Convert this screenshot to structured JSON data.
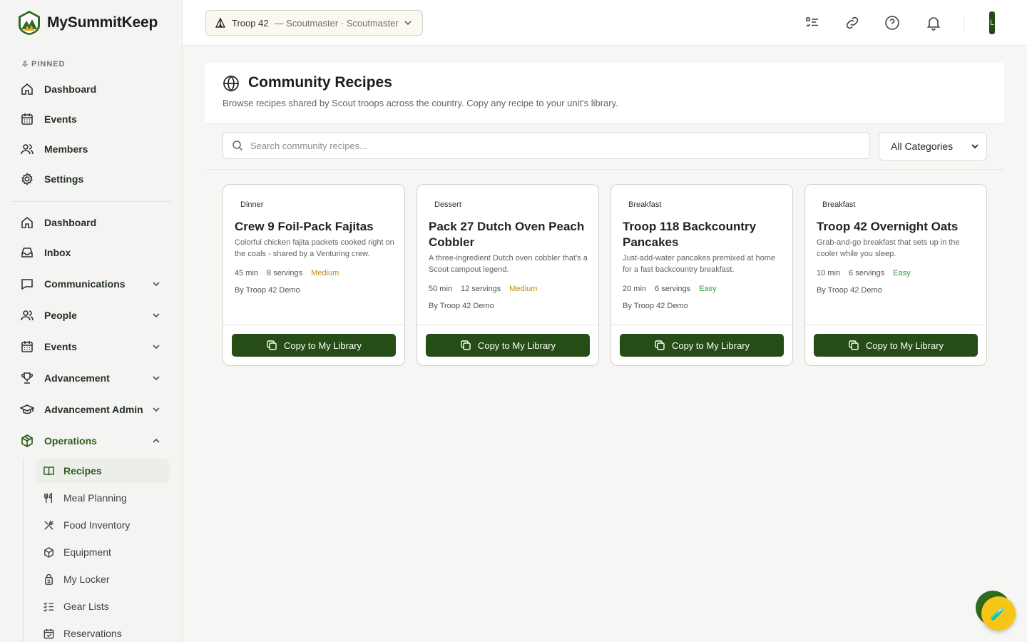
{
  "brand": {
    "name": "MySummitKeep"
  },
  "sidebar": {
    "pinned_label": "PINNED",
    "pinned": [
      {
        "label": "Dashboard",
        "icon": "home-icon"
      },
      {
        "label": "Events",
        "icon": "calendar-icon"
      },
      {
        "label": "Members",
        "icon": "users-icon"
      },
      {
        "label": "Settings",
        "icon": "gear-icon"
      }
    ],
    "nav": [
      {
        "label": "Dashboard",
        "icon": "home-icon"
      },
      {
        "label": "Inbox",
        "icon": "inbox-icon"
      },
      {
        "label": "Communications",
        "icon": "chat-icon",
        "expandable": true
      },
      {
        "label": "People",
        "icon": "users-icon",
        "expandable": true
      },
      {
        "label": "Events",
        "icon": "calendar-icon",
        "expandable": true
      },
      {
        "label": "Advancement",
        "icon": "trophy-icon",
        "expandable": true
      },
      {
        "label": "Advancement Admin",
        "icon": "graduation-cap-icon",
        "expandable": true
      },
      {
        "label": "Operations",
        "icon": "box-icon",
        "expandable": true,
        "expanded": true
      }
    ],
    "operations_items": [
      {
        "label": "Recipes",
        "icon": "book-icon",
        "active": true
      },
      {
        "label": "Meal Planning",
        "icon": "utensils-icon"
      },
      {
        "label": "Food Inventory",
        "icon": "crossed-utensils-icon"
      },
      {
        "label": "Equipment",
        "icon": "package-icon"
      },
      {
        "label": "My Locker",
        "icon": "lock-icon"
      },
      {
        "label": "Gear Lists",
        "icon": "checklist-icon"
      },
      {
        "label": "Reservations",
        "icon": "calendar-check-icon"
      }
    ]
  },
  "topbar": {
    "unit_name": "Troop 42",
    "unit_role": "— Scoutmaster · Scoutmaster",
    "avatar_initial": "L"
  },
  "page": {
    "title": "Community Recipes",
    "subtitle": "Browse recipes shared by Scout troops across the country. Copy any recipe to your unit's library."
  },
  "filters": {
    "search_placeholder": "Search community recipes...",
    "category_value": "All Categories"
  },
  "recipes": [
    {
      "category": "Dinner",
      "title": "Crew 9 Foil-Pack Fajitas",
      "description": "Colorful chicken fajita packets cooked right on the coals - shared by a Venturing crew.",
      "time": "45 min",
      "servings": "8 servings",
      "difficulty": "Medium",
      "author": "By Troop 42 Demo",
      "button": "Copy to My Library"
    },
    {
      "category": "Dessert",
      "title": "Pack 27 Dutch Oven Peach Cobbler",
      "description": "A three-ingredient Dutch oven cobbler that's a Scout campout legend.",
      "time": "50 min",
      "servings": "12 servings",
      "difficulty": "Medium",
      "author": "By Troop 42 Demo",
      "button": "Copy to My Library"
    },
    {
      "category": "Breakfast",
      "title": "Troop 118 Backcountry Pancakes",
      "description": "Just-add-water pancakes premixed at home for a fast backcountry breakfast.",
      "time": "20 min",
      "servings": "6 servings",
      "difficulty": "Easy",
      "author": "By Troop 42 Demo",
      "button": "Copy to My Library"
    },
    {
      "category": "Breakfast",
      "title": "Troop 42 Overnight Oats",
      "description": "Grab-and-go breakfast that sets up in the cooler while you sleep.",
      "time": "10 min",
      "servings": "6 servings",
      "difficulty": "Easy",
      "author": "By Troop 42 Demo",
      "button": "Copy to My Library"
    }
  ],
  "fab": {
    "icon": "test-tube-icon",
    "glyph": "🧪"
  },
  "colors": {
    "brand_green": "#274d16",
    "medium": "#c98a0a",
    "easy": "#2e9a3a",
    "fab_yellow": "#f5c518"
  }
}
